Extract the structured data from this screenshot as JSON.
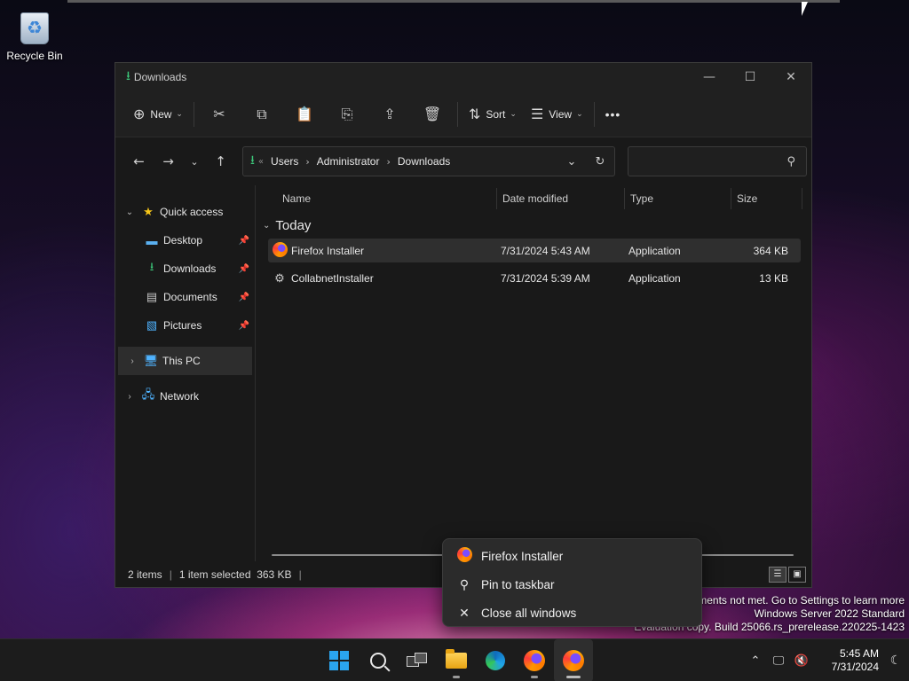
{
  "desktop": {
    "recycle_bin_label": "Recycle Bin"
  },
  "window": {
    "title": "Downloads",
    "controls": {
      "minimize": "—",
      "maximize": "☐",
      "close": "✕"
    }
  },
  "command_bar": {
    "new_label": "New",
    "sort_label": "Sort",
    "view_label": "View",
    "more_label": "•••"
  },
  "address": {
    "crumbs": [
      "Users",
      "Administrator",
      "Downloads"
    ],
    "search_placeholder": ""
  },
  "nav": {
    "quick_access": "Quick access",
    "desktop": "Desktop",
    "downloads": "Downloads",
    "documents": "Documents",
    "pictures": "Pictures",
    "this_pc": "This PC",
    "network": "Network"
  },
  "columns": {
    "name": "Name",
    "date": "Date modified",
    "type": "Type",
    "size": "Size"
  },
  "group_label": "Today",
  "files": [
    {
      "name": "Firefox Installer",
      "date": "7/31/2024 5:43 AM",
      "type": "Application",
      "size": "364 KB",
      "selected": true
    },
    {
      "name": "CollabnetInstaller",
      "date": "7/31/2024 5:39 AM",
      "type": "Application",
      "size": "13 KB",
      "selected": false
    }
  ],
  "status": {
    "items": "2 items",
    "selected": "1 item selected  363 KB"
  },
  "watermark": {
    "line1": "ments not met. Go to Settings to learn more",
    "line2": "Windows Server 2022 Standard",
    "line3": "Evaluation copy. Build 25066.rs_prerelease.220225-1423"
  },
  "jump_list": {
    "app": "Firefox Installer",
    "pin": "Pin to taskbar",
    "close": "Close all windows"
  },
  "clock": {
    "time": "5:45 AM",
    "date": "7/31/2024"
  },
  "colors": {
    "accent_green": "#3cc87a",
    "windows_blue": "#2aa5f0",
    "folder_yellow": "#ffd35a"
  }
}
